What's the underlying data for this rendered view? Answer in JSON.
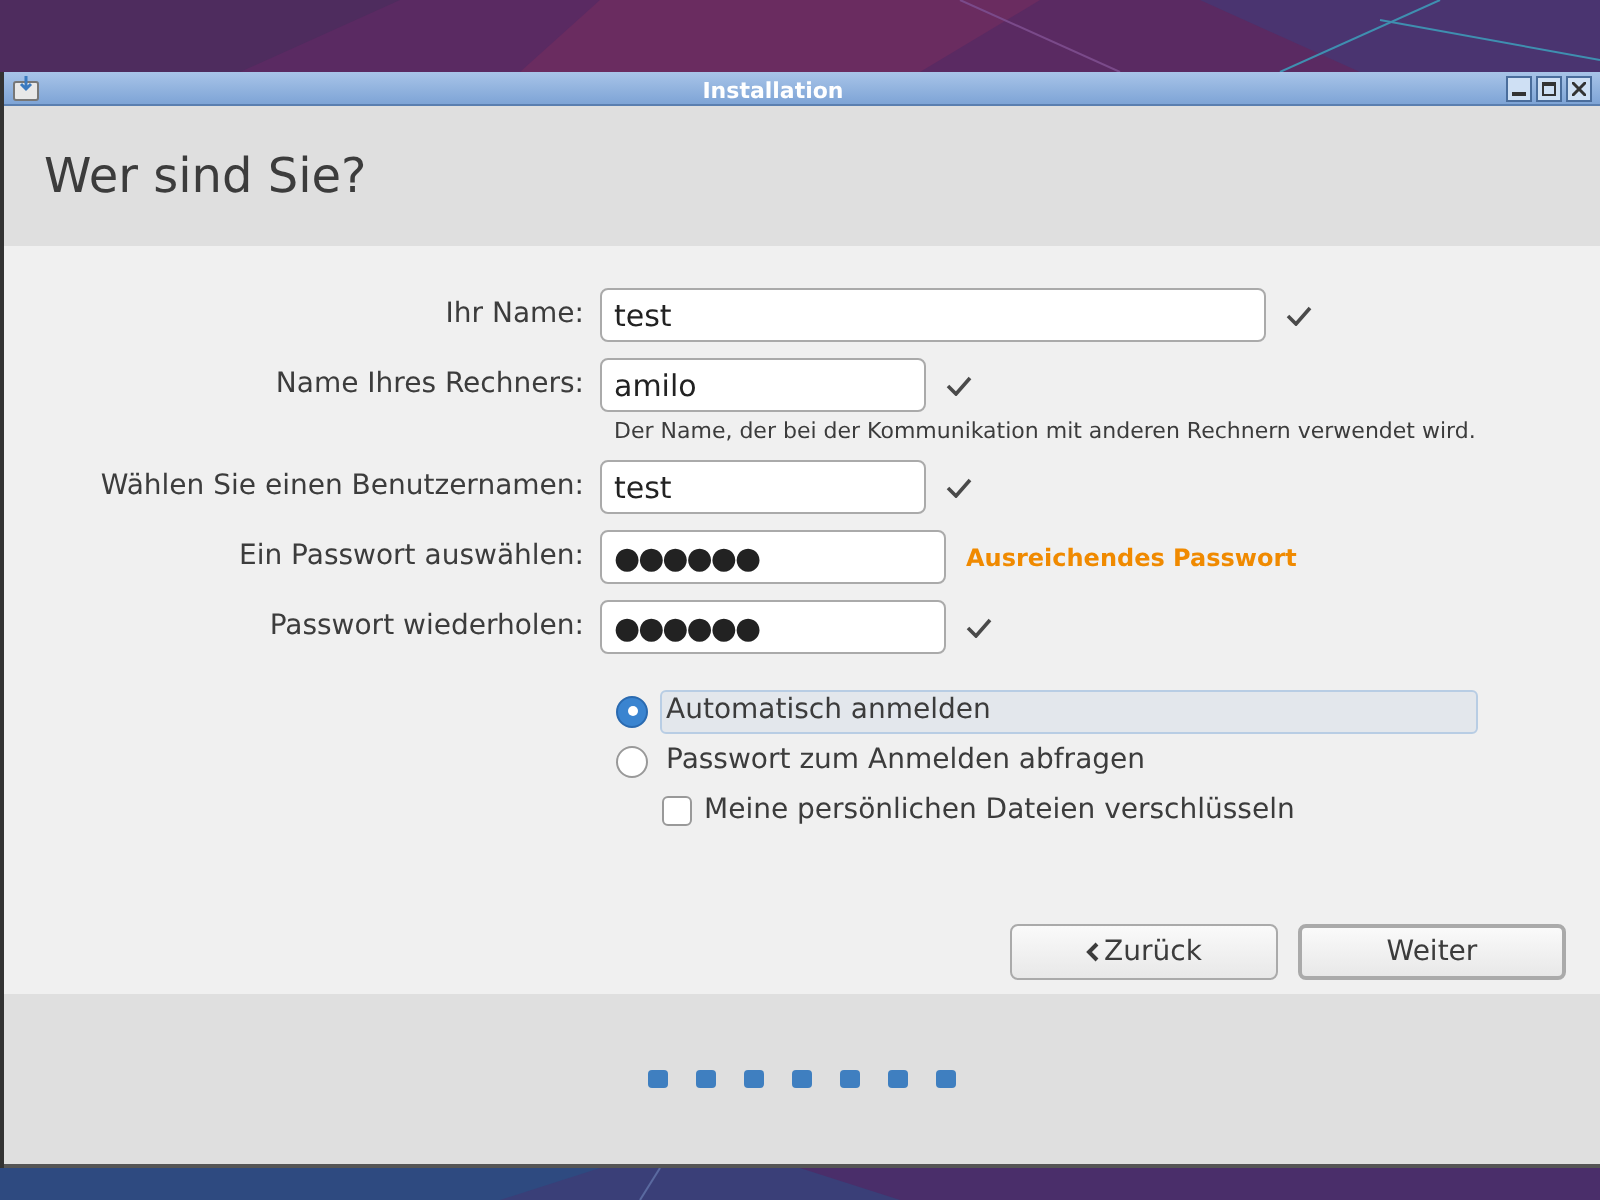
{
  "window": {
    "title": "Installation"
  },
  "heading": "Wer sind Sie?",
  "fields": [
    {
      "label": "Ihr Name:",
      "value": "test",
      "kind": "text",
      "status": {
        "kind": "check"
      }
    },
    {
      "label": "Name Ihres Rechners:",
      "value": "amilo",
      "kind": "text",
      "status": {
        "kind": "check"
      },
      "hint": "Der Name, der bei der Kommunikation mit anderen Rechnern verwendet wird."
    },
    {
      "label": "Wählen Sie einen Benutzernamen:",
      "value": "test",
      "kind": "text",
      "status": {
        "kind": "check"
      }
    },
    {
      "label": "Ein Passwort auswählen:",
      "value": "●●●●●●",
      "kind": "password",
      "status": {
        "kind": "strength",
        "text": "Ausreichendes Passwort"
      }
    },
    {
      "label": "Passwort wiederholen:",
      "value": "●●●●●●",
      "kind": "password",
      "status": {
        "kind": "check"
      }
    }
  ],
  "login_options": [
    {
      "label": "Automatisch anmelden",
      "selected": true
    },
    {
      "label": "Passwort zum Anmelden abfragen",
      "selected": false
    }
  ],
  "encrypt": {
    "label": "Meine persönlichen Dateien verschlüsseln",
    "checked": false
  },
  "buttons": [
    {
      "label": "Zurück",
      "kind": "back"
    },
    {
      "label": "Weiter",
      "kind": "next"
    }
  ]
}
